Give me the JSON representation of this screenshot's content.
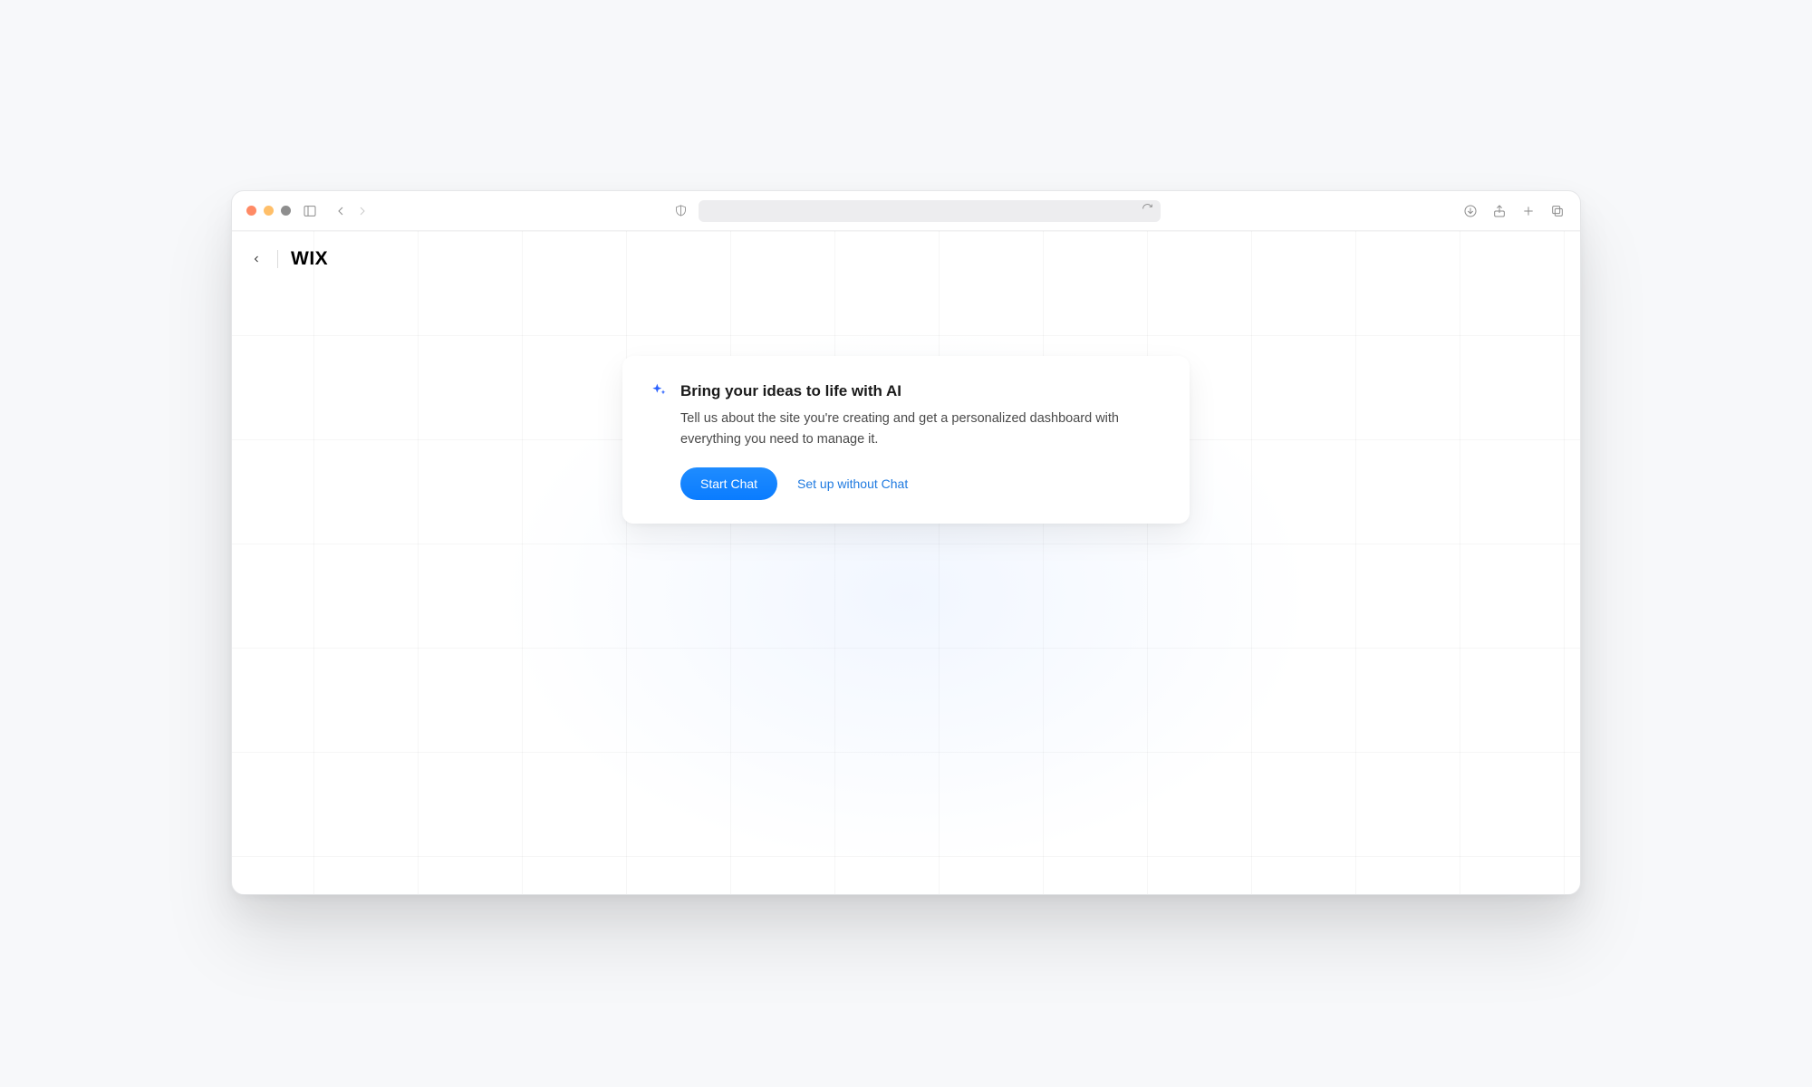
{
  "brand": "WIX",
  "card": {
    "title": "Bring your ideas to life with AI",
    "description": "Tell us about the site you're creating and get a personalized dashboard with everything you need to manage it.",
    "primary_label": "Start Chat",
    "secondary_label": "Set up without Chat"
  },
  "icons": {
    "sparkle": "sparkle-icon",
    "shield": "shield-icon",
    "refresh": "refresh-icon",
    "download": "download-icon",
    "share": "share-icon",
    "plus": "plus-icon",
    "copy": "copy-icon",
    "sidebar": "sidebar-icon",
    "back": "back-icon",
    "forward": "forward-icon",
    "page_back": "page-back-icon"
  }
}
